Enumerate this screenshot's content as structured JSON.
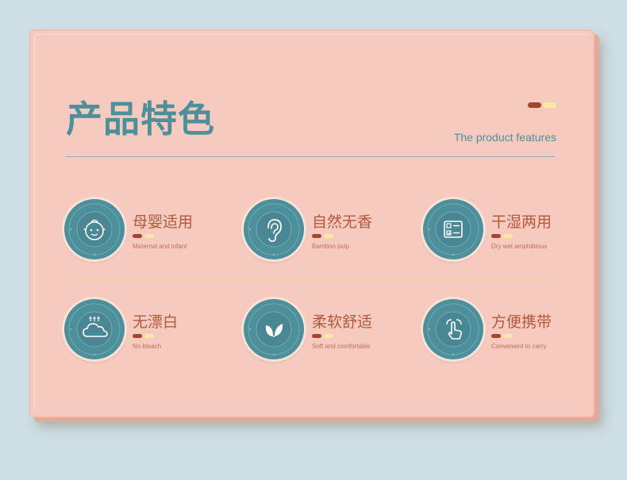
{
  "header": {
    "title": "产品特色",
    "subtitle": "The product features"
  },
  "colors": {
    "background": "#cddfe4",
    "card": "#f6cabe",
    "teal": "#4e8f9c",
    "accent_dark": "#a4452c",
    "accent_light": "#fbe9a3",
    "feature_title": "#b45a3c"
  },
  "features": [
    {
      "title": "母婴适用",
      "subtitle": "Maternal and infant",
      "icon": "baby-face-icon"
    },
    {
      "title": "自然无香",
      "subtitle": "Bamboo pulp",
      "icon": "ear-icon"
    },
    {
      "title": "干湿两用",
      "subtitle": "Dry wet amphibious",
      "icon": "checklist-icon"
    },
    {
      "title": "无漂白",
      "subtitle": "No bleach",
      "icon": "cloud-icon"
    },
    {
      "title": "柔软舒适",
      "subtitle": "Soft and comfortable",
      "icon": "leaf-icon"
    },
    {
      "title": "方便携带",
      "subtitle": "Convenient to carry",
      "icon": "touch-hand-icon"
    }
  ]
}
